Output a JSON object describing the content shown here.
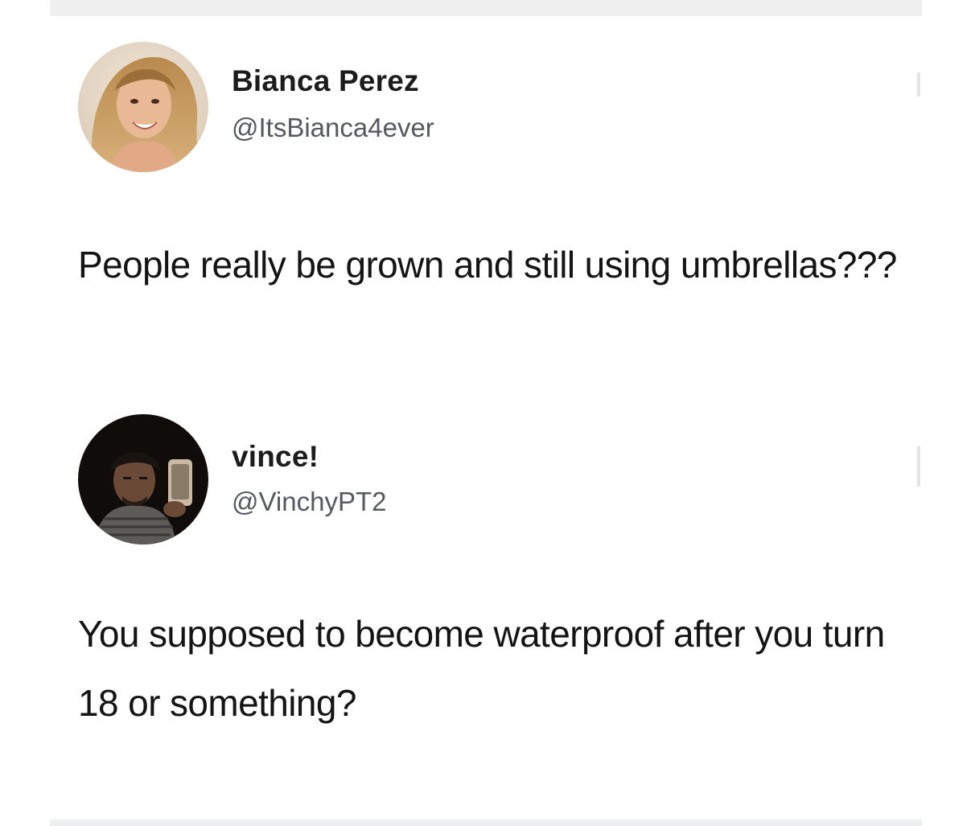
{
  "tweets": [
    {
      "display_name": "Bianca Perez",
      "handle": "@ItsBianca4ever",
      "text": "People really be grown and still using umbrellas???",
      "avatar": "avatar-photo"
    },
    {
      "display_name": "vince!",
      "handle": "@VinchyPT2",
      "text": "You supposed to become waterproof after you turn 18 or something?",
      "avatar": "avatar-photo"
    }
  ],
  "colors": {
    "background": "#ffffff",
    "name_text": "#1c1c1c",
    "handle_text": "#555a60",
    "body_text": "#141414"
  }
}
